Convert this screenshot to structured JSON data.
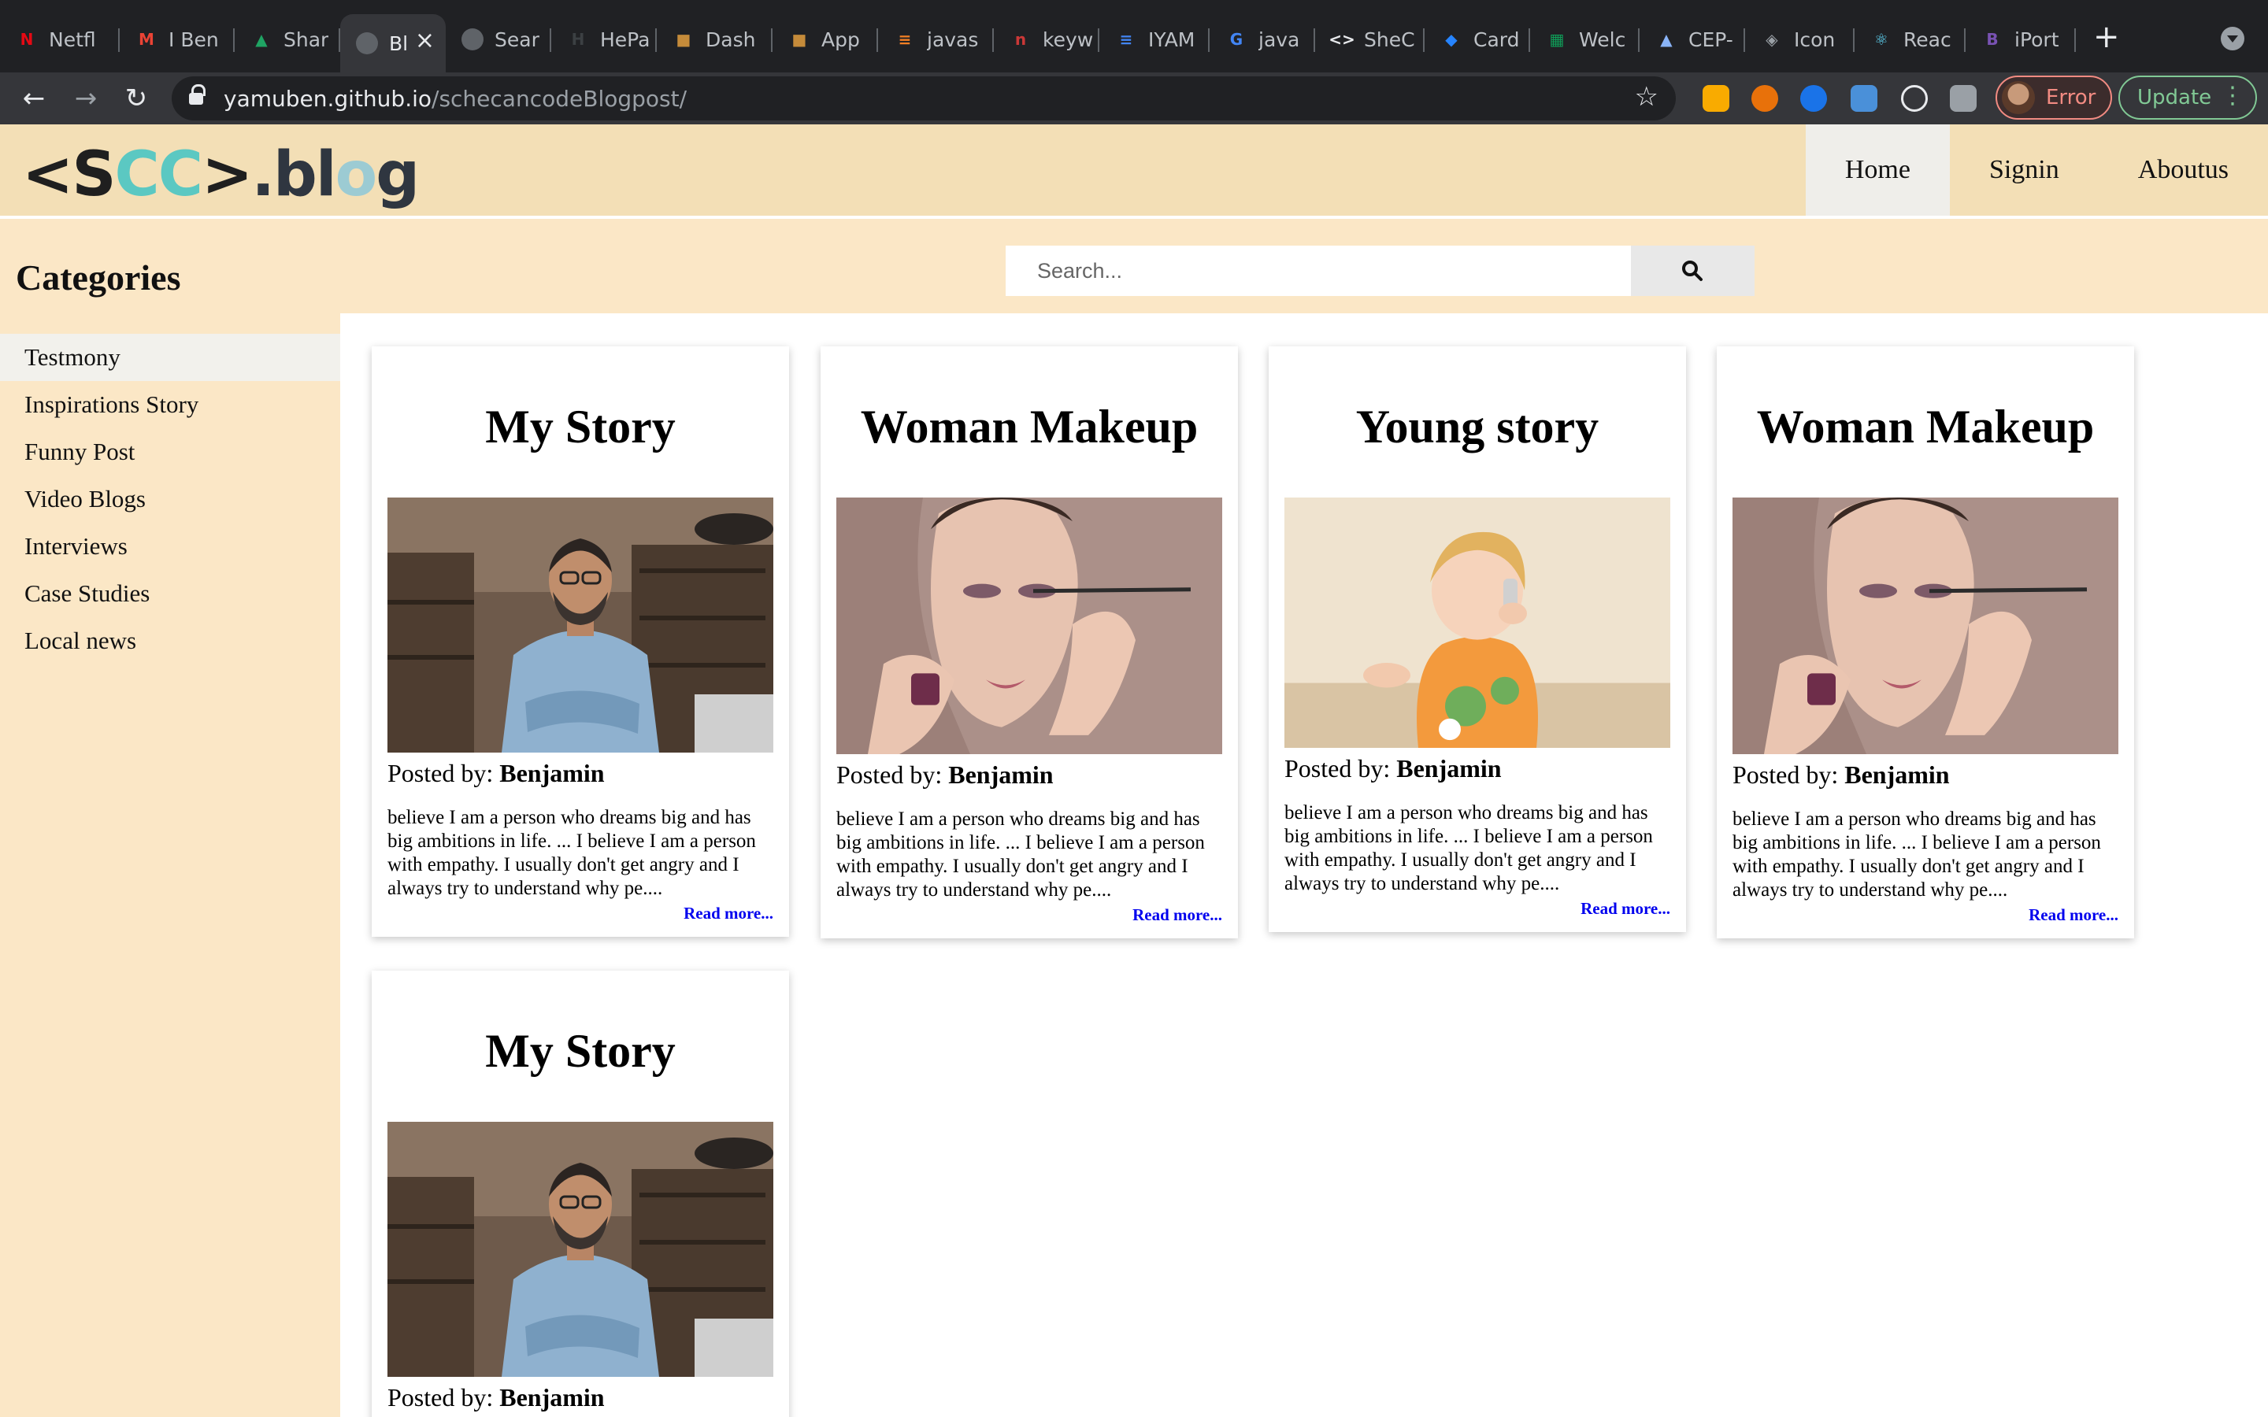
{
  "browser": {
    "tabs": [
      {
        "title": "Netfl",
        "icon": "netflix-icon",
        "color": "#e50914",
        "glyph": "N"
      },
      {
        "title": "I Ben",
        "icon": "gmail-icon",
        "color": "#ea4335",
        "glyph": "M"
      },
      {
        "title": "Shar",
        "icon": "drive-icon",
        "color": "#1fa463",
        "glyph": "▲"
      },
      {
        "title": "Bl",
        "icon": "globe-icon",
        "color": "#5f6368",
        "glyph": "",
        "active": true
      },
      {
        "title": "Sear",
        "icon": "globe-icon",
        "color": "#5f6368",
        "glyph": ""
      },
      {
        "title": "HePa",
        "icon": "hepa-icon",
        "color": "#3c4043",
        "glyph": "H"
      },
      {
        "title": "Dash",
        "icon": "box-icon",
        "color": "#c58b3a",
        "glyph": "■"
      },
      {
        "title": "App",
        "icon": "box-icon",
        "color": "#c58b3a",
        "glyph": "■"
      },
      {
        "title": "javas",
        "icon": "stackoverflow-icon",
        "color": "#f48024",
        "glyph": "≡"
      },
      {
        "title": "keyw",
        "icon": "npm-icon",
        "color": "#cb3837",
        "glyph": "n"
      },
      {
        "title": "IYAM",
        "icon": "docs-icon",
        "color": "#4285f4",
        "glyph": "≡"
      },
      {
        "title": "java",
        "icon": "google-icon",
        "color": "#4285f4",
        "glyph": "G"
      },
      {
        "title": "SheC",
        "icon": "code-icon",
        "color": "#e8eaed",
        "glyph": "<>"
      },
      {
        "title": "Card",
        "icon": "jira-icon",
        "color": "#2684ff",
        "glyph": "◆"
      },
      {
        "title": "Welc",
        "icon": "sheet-icon",
        "color": "#0f9d58",
        "glyph": "▦"
      },
      {
        "title": "CEP-",
        "icon": "doc-icon",
        "color": "#8ab4f8",
        "glyph": "▲"
      },
      {
        "title": "Icon",
        "icon": "cube-icon",
        "color": "#9aa0a6",
        "glyph": "◈"
      },
      {
        "title": "Reac",
        "icon": "react-icon",
        "color": "#61dafb",
        "glyph": "⚛"
      },
      {
        "title": "iPort",
        "icon": "bootstrap-icon",
        "color": "#7952b3",
        "glyph": "B"
      }
    ],
    "url_host": "yamuben.github.io",
    "url_path": "/schecancodeBlogpost/",
    "profile_label": "Error",
    "update_label": "Update"
  },
  "site": {
    "logo": {
      "lt": "<",
      "s": "S",
      "c1": "C",
      "c2": "C",
      "gt": ">",
      "dot": ".",
      "b": "b",
      "l": "l",
      "o": "o",
      "g": "g"
    },
    "nav": [
      "Home",
      "Signin",
      "Aboutus"
    ],
    "categories_title": "Categories",
    "categories": [
      "Testmony",
      "Inspirations Story",
      "Funny Post",
      "Video Blogs",
      "Interviews",
      "Case Studies",
      "Local news"
    ],
    "search_placeholder": "Search...",
    "posted_label": "Posted by:",
    "read_more": "Read more...",
    "cards": [
      {
        "title": "My Story",
        "author": "Benjamin",
        "image": "man-portrait",
        "excerpt": "believe I am a person who dreams big and has big ambitions in life. ... I believe I am a person with empathy. I usually don't get angry and I always try to understand why pe...."
      },
      {
        "title": "Woman Makeup",
        "author": "Benjamin",
        "image": "woman-makeup",
        "excerpt": "believe I am a person who dreams big and has big ambitions in life. ... I believe I am a person with empathy. I usually don't get angry and I always try to understand why pe...."
      },
      {
        "title": "Young story",
        "author": "Benjamin",
        "image": "child-phone",
        "excerpt": "believe I am a person who dreams big and has big ambitions in life. ... I believe I am a person with empathy. I usually don't get angry and I always try to understand why pe...."
      },
      {
        "title": "Woman Makeup",
        "author": "Benjamin",
        "image": "woman-makeup",
        "excerpt": "believe I am a person who dreams big and has big ambitions in life. ... I believe I am a person with empathy. I usually don't get angry and I always try to understand why pe...."
      },
      {
        "title": "My Story",
        "author": "Benjamin",
        "image": "man-portrait",
        "excerpt": ""
      }
    ]
  }
}
